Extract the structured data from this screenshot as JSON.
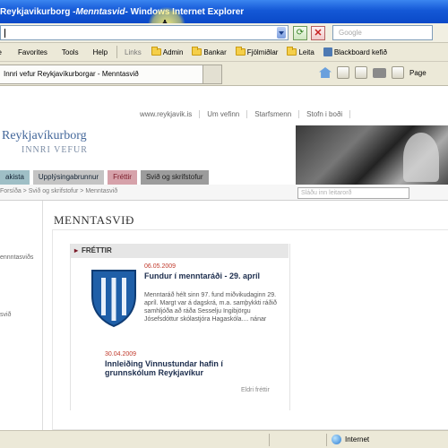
{
  "window": {
    "title_prefix": "Reykjavikurborg - ",
    "title_page": "Menntasvid",
    "title_suffix": " - Windows Internet Explorer"
  },
  "address": {
    "value": "",
    "search_placeholder": "Google"
  },
  "menu": {
    "items": [
      "File",
      "Favorites",
      "Tools",
      "Help"
    ],
    "links_label": "Links",
    "links": [
      "Admin",
      "Bankar",
      "Fjölmiðlar",
      "Leita",
      "Blackboard kefið"
    ]
  },
  "tab": {
    "label": "Innri vefur Reykjavíkurborgar - Menntasvið",
    "toolbar_page": "Page"
  },
  "site": {
    "top_links": [
      "www.reykjavik.is",
      "Um vefinn",
      "Starfsmenn",
      "Stofn i boði"
    ],
    "logo_line1": "Reykjavíkurborg",
    "logo_line2": "INNRI VEFUR",
    "nav_tabs": [
      "akista",
      "Upplýsingabrunnur",
      "Fréttir",
      "Svið og skrifstofur"
    ],
    "breadcrumb": "Forsíða > Svið og skrifstofur > Menntasvið",
    "search_placeholder": "Sláðu inn leitarorð",
    "page_title": "MENNTASVIÐ",
    "left_nav": [
      "",
      "ennntasviðs",
      "",
      "",
      "svið",
      "",
      "",
      ""
    ]
  },
  "news": {
    "heading": "FRÉTTIR",
    "items": [
      {
        "date": "06.05.2009",
        "title": "Fundur í menntaráði - 29. apríl",
        "text": "Menntaráð hélt sinn 97. fund miðvikudaginn 29. apríl. Margt var á dagskrá, m.a. samþykkti ráðið samhljóða að ráða Sesselju Ingibjörgu Jósefsdóttur skólastjóra Hagaskóla.... nánar"
      },
      {
        "date": "30.04.2009",
        "title": "Innleiðing Vinnustundar hafin í grunnskólum Reykjavíkur",
        "text": ""
      }
    ],
    "older_link": "Eldri fréttir"
  },
  "status": {
    "zone": "Internet"
  },
  "colors": {
    "title_bar": "#1458d6",
    "nav_news": "#d6a2aa",
    "logo": "#43679a"
  }
}
